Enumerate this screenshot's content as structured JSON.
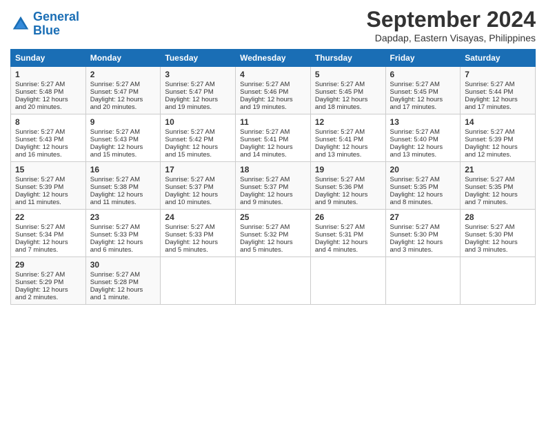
{
  "header": {
    "logo_line1": "General",
    "logo_line2": "Blue",
    "month": "September 2024",
    "location": "Dapdap, Eastern Visayas, Philippines"
  },
  "columns": [
    "Sunday",
    "Monday",
    "Tuesday",
    "Wednesday",
    "Thursday",
    "Friday",
    "Saturday"
  ],
  "rows": [
    [
      {
        "day": "",
        "info": ""
      },
      {
        "day": "2",
        "info": "Sunrise: 5:27 AM\nSunset: 5:47 PM\nDaylight: 12 hours\nand 20 minutes."
      },
      {
        "day": "3",
        "info": "Sunrise: 5:27 AM\nSunset: 5:47 PM\nDaylight: 12 hours\nand 19 minutes."
      },
      {
        "day": "4",
        "info": "Sunrise: 5:27 AM\nSunset: 5:46 PM\nDaylight: 12 hours\nand 19 minutes."
      },
      {
        "day": "5",
        "info": "Sunrise: 5:27 AM\nSunset: 5:45 PM\nDaylight: 12 hours\nand 18 minutes."
      },
      {
        "day": "6",
        "info": "Sunrise: 5:27 AM\nSunset: 5:45 PM\nDaylight: 12 hours\nand 17 minutes."
      },
      {
        "day": "7",
        "info": "Sunrise: 5:27 AM\nSunset: 5:44 PM\nDaylight: 12 hours\nand 17 minutes."
      }
    ],
    [
      {
        "day": "1",
        "info": "Sunrise: 5:27 AM\nSunset: 5:48 PM\nDaylight: 12 hours\nand 20 minutes."
      },
      {
        "day": "",
        "info": ""
      },
      {
        "day": "",
        "info": ""
      },
      {
        "day": "",
        "info": ""
      },
      {
        "day": "",
        "info": ""
      },
      {
        "day": "",
        "info": ""
      },
      {
        "day": "",
        "info": ""
      }
    ],
    [
      {
        "day": "8",
        "info": "Sunrise: 5:27 AM\nSunset: 5:43 PM\nDaylight: 12 hours\nand 16 minutes."
      },
      {
        "day": "9",
        "info": "Sunrise: 5:27 AM\nSunset: 5:43 PM\nDaylight: 12 hours\nand 15 minutes."
      },
      {
        "day": "10",
        "info": "Sunrise: 5:27 AM\nSunset: 5:42 PM\nDaylight: 12 hours\nand 15 minutes."
      },
      {
        "day": "11",
        "info": "Sunrise: 5:27 AM\nSunset: 5:41 PM\nDaylight: 12 hours\nand 14 minutes."
      },
      {
        "day": "12",
        "info": "Sunrise: 5:27 AM\nSunset: 5:41 PM\nDaylight: 12 hours\nand 13 minutes."
      },
      {
        "day": "13",
        "info": "Sunrise: 5:27 AM\nSunset: 5:40 PM\nDaylight: 12 hours\nand 13 minutes."
      },
      {
        "day": "14",
        "info": "Sunrise: 5:27 AM\nSunset: 5:39 PM\nDaylight: 12 hours\nand 12 minutes."
      }
    ],
    [
      {
        "day": "15",
        "info": "Sunrise: 5:27 AM\nSunset: 5:39 PM\nDaylight: 12 hours\nand 11 minutes."
      },
      {
        "day": "16",
        "info": "Sunrise: 5:27 AM\nSunset: 5:38 PM\nDaylight: 12 hours\nand 11 minutes."
      },
      {
        "day": "17",
        "info": "Sunrise: 5:27 AM\nSunset: 5:37 PM\nDaylight: 12 hours\nand 10 minutes."
      },
      {
        "day": "18",
        "info": "Sunrise: 5:27 AM\nSunset: 5:37 PM\nDaylight: 12 hours\nand 9 minutes."
      },
      {
        "day": "19",
        "info": "Sunrise: 5:27 AM\nSunset: 5:36 PM\nDaylight: 12 hours\nand 9 minutes."
      },
      {
        "day": "20",
        "info": "Sunrise: 5:27 AM\nSunset: 5:35 PM\nDaylight: 12 hours\nand 8 minutes."
      },
      {
        "day": "21",
        "info": "Sunrise: 5:27 AM\nSunset: 5:35 PM\nDaylight: 12 hours\nand 7 minutes."
      }
    ],
    [
      {
        "day": "22",
        "info": "Sunrise: 5:27 AM\nSunset: 5:34 PM\nDaylight: 12 hours\nand 7 minutes."
      },
      {
        "day": "23",
        "info": "Sunrise: 5:27 AM\nSunset: 5:33 PM\nDaylight: 12 hours\nand 6 minutes."
      },
      {
        "day": "24",
        "info": "Sunrise: 5:27 AM\nSunset: 5:33 PM\nDaylight: 12 hours\nand 5 minutes."
      },
      {
        "day": "25",
        "info": "Sunrise: 5:27 AM\nSunset: 5:32 PM\nDaylight: 12 hours\nand 5 minutes."
      },
      {
        "day": "26",
        "info": "Sunrise: 5:27 AM\nSunset: 5:31 PM\nDaylight: 12 hours\nand 4 minutes."
      },
      {
        "day": "27",
        "info": "Sunrise: 5:27 AM\nSunset: 5:30 PM\nDaylight: 12 hours\nand 3 minutes."
      },
      {
        "day": "28",
        "info": "Sunrise: 5:27 AM\nSunset: 5:30 PM\nDaylight: 12 hours\nand 3 minutes."
      }
    ],
    [
      {
        "day": "29",
        "info": "Sunrise: 5:27 AM\nSunset: 5:29 PM\nDaylight: 12 hours\nand 2 minutes."
      },
      {
        "day": "30",
        "info": "Sunrise: 5:27 AM\nSunset: 5:28 PM\nDaylight: 12 hours\nand 1 minute."
      },
      {
        "day": "",
        "info": ""
      },
      {
        "day": "",
        "info": ""
      },
      {
        "day": "",
        "info": ""
      },
      {
        "day": "",
        "info": ""
      },
      {
        "day": "",
        "info": ""
      }
    ]
  ]
}
